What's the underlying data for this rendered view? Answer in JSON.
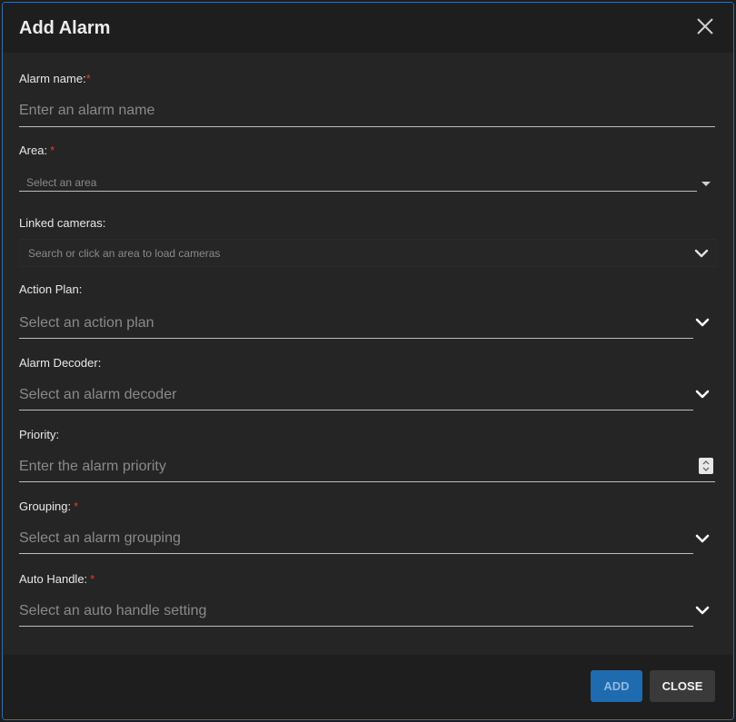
{
  "dialog": {
    "title": "Add Alarm",
    "close_icon": "close-icon"
  },
  "fields": {
    "alarm_name": {
      "label": "Alarm name:",
      "required": "*",
      "placeholder": "Enter an alarm name"
    },
    "area": {
      "label": "Area:",
      "required": "*",
      "placeholder": "Select an area",
      "icon": "caret-down-icon"
    },
    "linked_cameras": {
      "label": "Linked cameras:",
      "placeholder": "Search or click an area to load cameras",
      "icon": "chevron-down-icon"
    },
    "action_plan": {
      "label": "Action Plan:",
      "placeholder": "Select an action plan",
      "icon": "chevron-down-icon"
    },
    "alarm_decoder": {
      "label": "Alarm Decoder:",
      "placeholder": "Select an alarm decoder",
      "icon": "chevron-down-icon"
    },
    "priority": {
      "label": "Priority:",
      "placeholder": "Enter the alarm priority",
      "icon": "spinner-icon"
    },
    "grouping": {
      "label": "Grouping:",
      "required": "*",
      "placeholder": "Select an alarm grouping",
      "icon": "chevron-down-icon"
    },
    "auto_handle": {
      "label": "Auto Handle:",
      "required": "*",
      "placeholder": "Select an auto handle setting",
      "icon": "chevron-down-icon"
    }
  },
  "footer": {
    "add_label": "ADD",
    "close_label": "CLOSE"
  },
  "colors": {
    "accent": "#1f6bb0",
    "required": "#e53935",
    "background": "#252525"
  }
}
